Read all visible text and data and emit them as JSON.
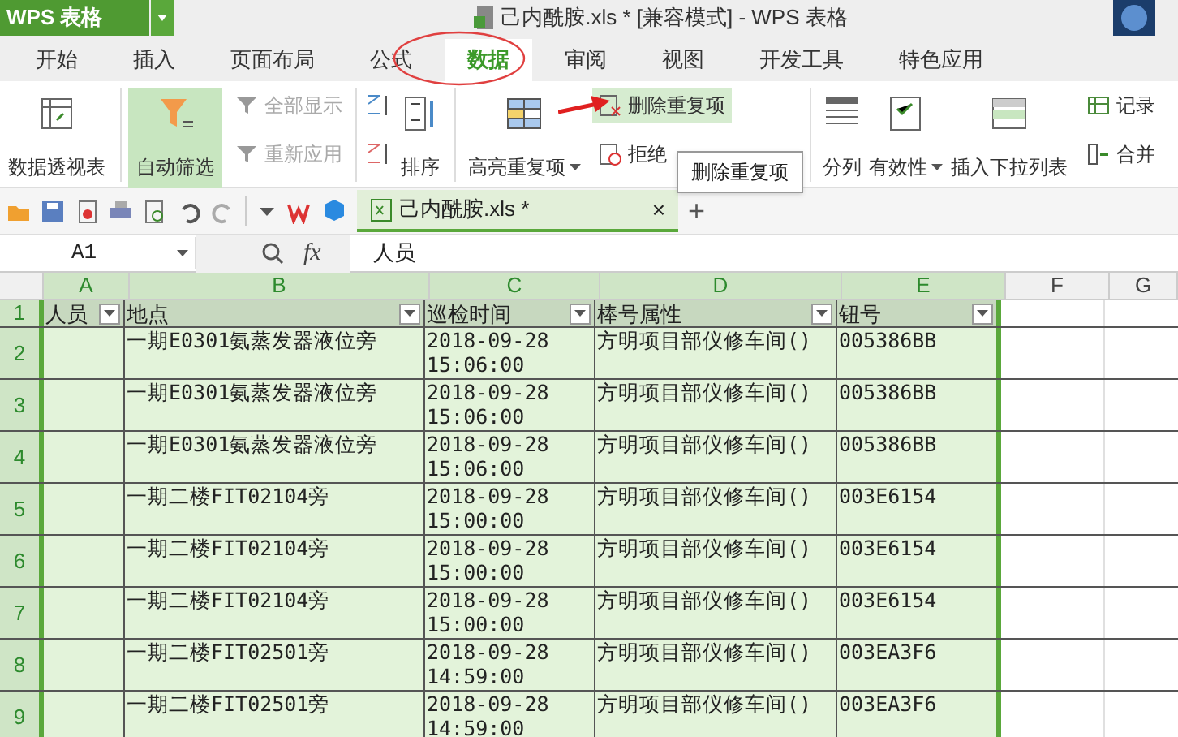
{
  "app_button": {
    "label": "WPS 表格"
  },
  "window": {
    "title": "己内酰胺.xls * [兼容模式] - WPS 表格"
  },
  "menu_tabs": [
    {
      "label": "开始",
      "selected": false
    },
    {
      "label": "插入",
      "selected": false
    },
    {
      "label": "页面布局",
      "selected": false
    },
    {
      "label": "公式",
      "selected": false
    },
    {
      "label": "数据",
      "selected": true
    },
    {
      "label": "审阅",
      "selected": false
    },
    {
      "label": "视图",
      "selected": false
    },
    {
      "label": "开发工具",
      "selected": false
    },
    {
      "label": "特色应用",
      "selected": false
    }
  ],
  "ribbon": {
    "pivot": "数据透视表",
    "autofilter": {
      "label": "自动筛选",
      "on": true
    },
    "show_all": {
      "label": "全部显示",
      "disabled": true
    },
    "reapply": {
      "label": "重新应用",
      "disabled": true
    },
    "sort": "排序",
    "highlight_dup": "高亮重复项",
    "delete_dup": {
      "label": "删除重复项",
      "hovered": true
    },
    "reject_dup": "拒绝",
    "split": "分列",
    "validity": "有效性",
    "dropdown_list": "插入下拉列表",
    "record": "记录",
    "merge": "合并"
  },
  "tooltip": "删除重复项",
  "doc_tab": {
    "label": "己内酰胺.xls *",
    "close": "×",
    "add": "+"
  },
  "formula_bar": {
    "cell_ref": "A1",
    "fx": "fx",
    "value": "人员"
  },
  "sheet": {
    "columns": [
      "A",
      "B",
      "C",
      "D",
      "E",
      "F",
      "G"
    ],
    "header": [
      "人员",
      "地点",
      "巡检时间",
      "棒号属性",
      "钮号"
    ],
    "rows": [
      {
        "num": "1"
      },
      {
        "num": "2",
        "cells": [
          "",
          "一期E0301氨蒸发器液位旁",
          "2018-09-28\n15:06:00",
          "方明项目部仪修车间()",
          "005386BB"
        ]
      },
      {
        "num": "3",
        "cells": [
          "",
          "一期E0301氨蒸发器液位旁",
          "2018-09-28\n15:06:00",
          "方明项目部仪修车间()",
          "005386BB"
        ]
      },
      {
        "num": "4",
        "cells": [
          "",
          "一期E0301氨蒸发器液位旁",
          "2018-09-28\n15:06:00",
          "方明项目部仪修车间()",
          "005386BB"
        ]
      },
      {
        "num": "5",
        "cells": [
          "",
          "一期二楼FIT02104旁",
          "2018-09-28\n15:00:00",
          "方明项目部仪修车间()",
          "003E6154"
        ]
      },
      {
        "num": "6",
        "cells": [
          "",
          "一期二楼FIT02104旁",
          "2018-09-28\n15:00:00",
          "方明项目部仪修车间()",
          "003E6154"
        ]
      },
      {
        "num": "7",
        "cells": [
          "",
          "一期二楼FIT02104旁",
          "2018-09-28\n15:00:00",
          "方明项目部仪修车间()",
          "003E6154"
        ]
      },
      {
        "num": "8",
        "cells": [
          "",
          "一期二楼FIT02501旁",
          "2018-09-28\n14:59:00",
          "方明项目部仪修车间()",
          "003EA3F6"
        ]
      },
      {
        "num": "9",
        "cells": [
          "",
          "一期二楼FIT02501旁",
          "2018-09-28\n14:59:00",
          "方明项目部仪修车间()",
          "003EA3F6"
        ]
      }
    ]
  }
}
